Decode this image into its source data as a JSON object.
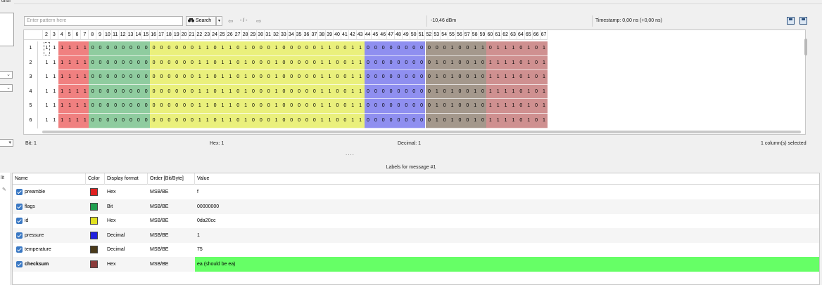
{
  "left": {
    "cut_label": "ditor",
    "combo_arrow": "⌄",
    "lt_label": "lit",
    "lt_icon": "✎"
  },
  "toolbar": {
    "search_placeholder": "Enter pattern here",
    "search_label": "Search",
    "search_icon": "binoculars-icon",
    "dropdown_icon": "▾",
    "nav_text": "- / -",
    "rssi": "-10,46 dBm",
    "timestamp": "Timestamp:  0,00 ns (+0,00 ns)",
    "icons": [
      "save-icon",
      "save-as-icon"
    ]
  },
  "bit_table": {
    "col_start": 2,
    "col_end": 67,
    "row_labels": [
      "1",
      "2",
      "3",
      "4",
      "5",
      "6"
    ],
    "segments": [
      {
        "name": "preamble",
        "start": 4,
        "end": 7,
        "color": "#f08080"
      },
      {
        "name": "flags",
        "start": 8,
        "end": 15,
        "color": "#8fcc9f"
      },
      {
        "name": "id",
        "start": 16,
        "end": 43,
        "color": "#eaf07c"
      },
      {
        "name": "pressure",
        "start": 44,
        "end": 51,
        "color": "#8f8ff0"
      },
      {
        "name": "temperature",
        "start": 52,
        "end": 59,
        "color": "#a4988c"
      },
      {
        "name": "checksum",
        "start": 60,
        "end": 67,
        "color": "#cf9090"
      }
    ],
    "rows": [
      "1111110000000000000011011010001000001100110000000000010011011101010",
      "1111110000000000000011011010001000001100110000000001010010111101010",
      "1111110000000000000011011010001000001100110000000001010010111101010",
      "1111110000000000000011011010001000001100110000000001010010111101010",
      "1111110000000000000011011010001000001100110000000001010010111101010",
      "1111110000000000000011011010001000001100110000000001010010111101010"
    ]
  },
  "info": {
    "bit": "Bit:  1",
    "hex": "Hex:  1",
    "decimal": "Decimal:  1",
    "selected": "1 column(s) selected",
    "splitter": "....",
    "labels_title": "Labels for message #1"
  },
  "labels_table": {
    "columns": [
      "Name",
      "Color",
      "Display format",
      "Order [Bit/Byte]",
      "Value"
    ],
    "rows": [
      {
        "name": "preamble",
        "color": "#e02020",
        "format": "Hex",
        "order": "MSB/BE",
        "value": "f",
        "bold": false,
        "highlight": false
      },
      {
        "name": "flags",
        "color": "#20a050",
        "format": "Bit",
        "order": "MSB/BE",
        "value": "00000000",
        "bold": false,
        "highlight": false
      },
      {
        "name": "id",
        "color": "#e0e020",
        "format": "Hex",
        "order": "MSB/BE",
        "value": "0da20cc",
        "bold": false,
        "highlight": false
      },
      {
        "name": "pressure",
        "color": "#2020e0",
        "format": "Decimal",
        "order": "MSB/BE",
        "value": "1",
        "bold": false,
        "highlight": false
      },
      {
        "name": "temperature",
        "color": "#4a3a1a",
        "format": "Decimal",
        "order": "MSB/BE",
        "value": "75",
        "bold": false,
        "highlight": false
      },
      {
        "name": "checksum",
        "color": "#8a3a3a",
        "format": "Hex",
        "order": "MSB/BE",
        "value": "ea (should be ea)",
        "bold": true,
        "highlight": true
      }
    ]
  }
}
